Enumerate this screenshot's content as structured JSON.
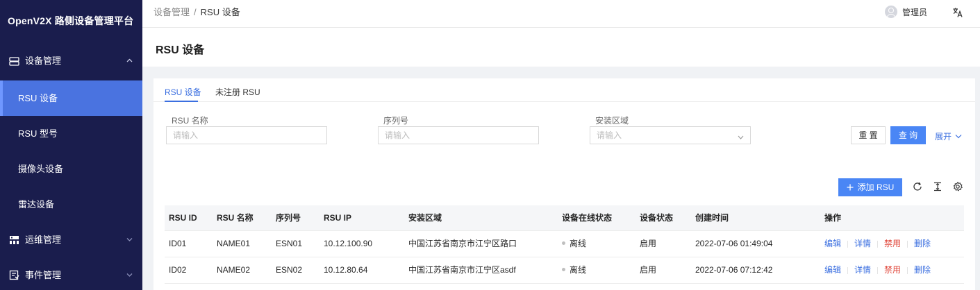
{
  "app": {
    "title": "OpenV2X 路侧设备管理平台"
  },
  "sidebar": {
    "groups": [
      {
        "label": "设备管理",
        "icon": "device-icon",
        "expanded": true
      },
      {
        "label": "运维管理",
        "icon": "ops-icon",
        "expanded": false
      },
      {
        "label": "事件管理",
        "icon": "event-icon",
        "expanded": false
      }
    ],
    "items": [
      {
        "label": "RSU 设备",
        "active": true
      },
      {
        "label": "RSU 型号",
        "active": false
      },
      {
        "label": "摄像头设备",
        "active": false
      },
      {
        "label": "雷达设备",
        "active": false
      }
    ]
  },
  "header": {
    "breadcrumb": [
      "设备管理",
      "RSU 设备"
    ],
    "breadcrumb_sep": "/",
    "user": "管理员",
    "lang_icon": "translate-icon"
  },
  "page": {
    "title": "RSU 设备"
  },
  "tabs": [
    {
      "label": "RSU 设备",
      "active": true
    },
    {
      "label": "未注册 RSU",
      "active": false
    }
  ],
  "filters": {
    "name": {
      "label": "RSU 名称",
      "placeholder": "请输入"
    },
    "serial": {
      "label": "序列号",
      "placeholder": "请输入"
    },
    "area": {
      "label": "安装区域",
      "placeholder": "请输入"
    },
    "reset_label": "重 置",
    "query_label": "查 询",
    "expand_label": "展开"
  },
  "toolbar": {
    "add_label": "添加 RSU",
    "add_icon": "plus"
  },
  "table": {
    "columns": [
      "RSU ID",
      "RSU 名称",
      "序列号",
      "RSU IP",
      "安装区域",
      "设备在线状态",
      "设备状态",
      "创建时间",
      "操作"
    ],
    "rows": [
      [
        "ID01",
        "NAME01",
        "ESN01",
        "10.12.100.90",
        "中国江苏省南京市江宁区路口",
        "离线",
        "启用",
        "2022-07-06 01:49:04"
      ],
      [
        "ID02",
        "NAME02",
        "ESN02",
        "10.12.80.64",
        "中国江苏省南京市江宁区asdf",
        "离线",
        "启用",
        "2022-07-06 07:12:42"
      ]
    ],
    "actions": [
      "编辑",
      "详情",
      "禁用",
      "删除"
    ]
  },
  "colors": {
    "sidebar_bg": "#1a1d4d",
    "active_item": "#4a73e0",
    "primary": "#4a86f5",
    "danger": "#e0473b"
  }
}
